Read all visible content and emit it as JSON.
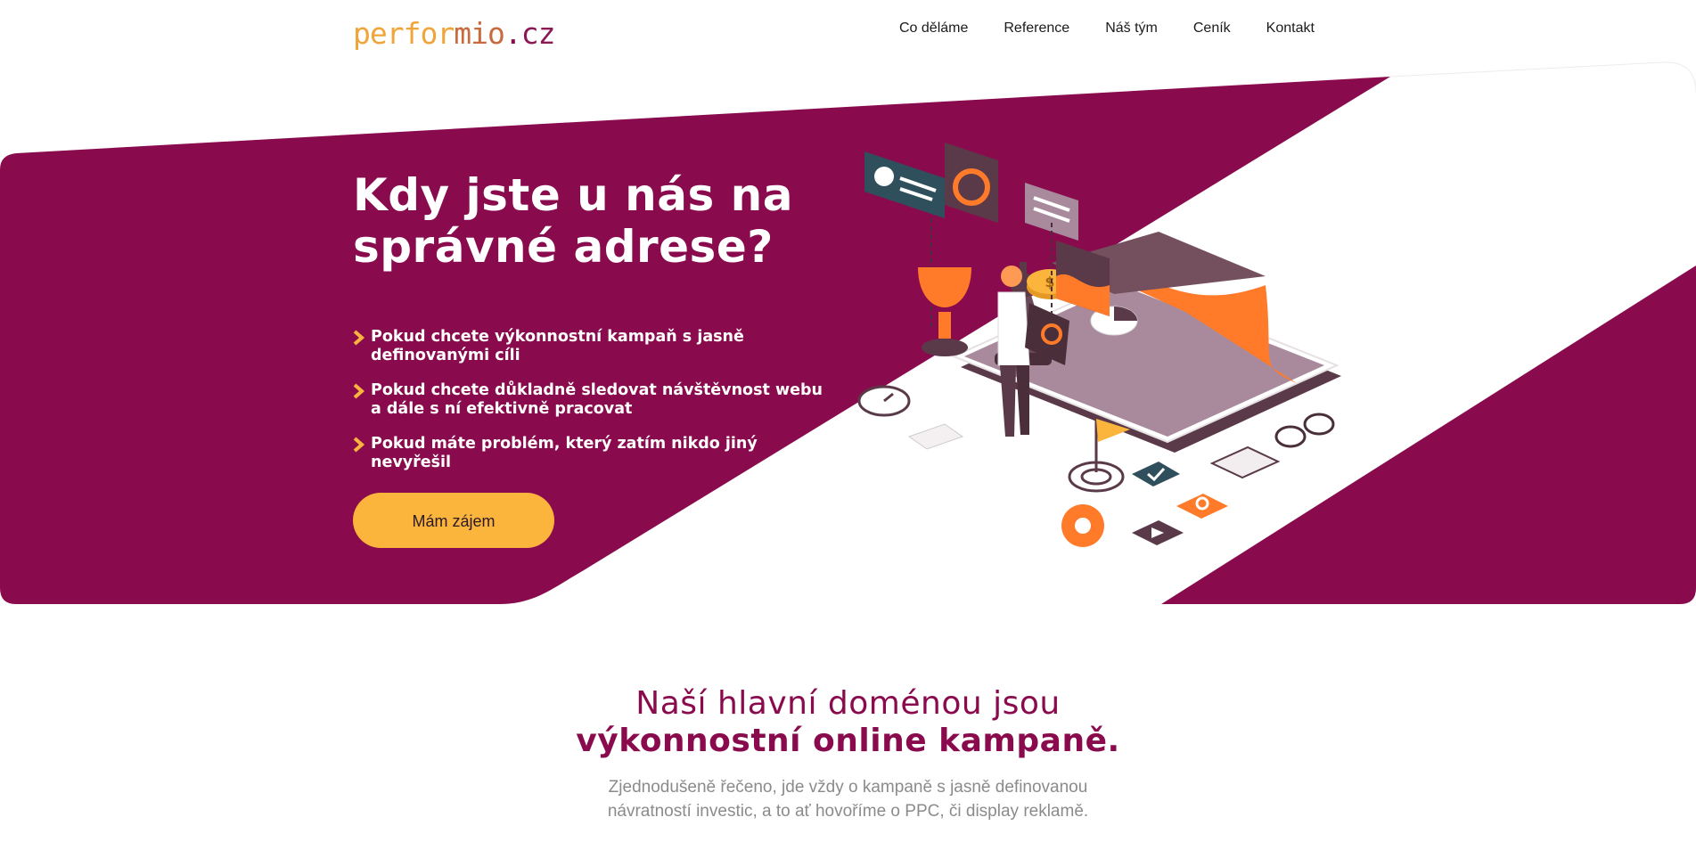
{
  "header": {
    "logo": {
      "part1": "perfor",
      "part2": "mio",
      "dot": ".",
      "part3": "cz"
    },
    "nav": [
      "Co děláme",
      "Reference",
      "Náš tým",
      "Ceník",
      "Kontakt"
    ]
  },
  "hero": {
    "title_line1": "Kdy jste u nás na",
    "title_line2": "správné adrese?",
    "bullets": [
      "Pokud chcete výkonnostní kampaň s jasně definovanými cíli",
      "Pokud chcete důkladně sledovat návštěvnost webu a dále s ní efektivně pracovat",
      "Pokud máte problém, který zatím nikdo jiný nevyřešil"
    ],
    "cta": "Mám zájem",
    "illustration_coin": "$"
  },
  "domain_section": {
    "heading_line1": "Naší hlavní doménou jsou",
    "heading_line2": "výkonnostní online kampaně.",
    "text": "Zjednodušeně řečeno, jde vždy o kampaně s jasně definovanou návratností investic, a to ať hovoříme o PPC, či display reklamě."
  },
  "colors": {
    "brand": "#8a0b4d",
    "accent": "#fbb43c",
    "orange": "#ff8a2a",
    "mauve": "#a07a94"
  }
}
